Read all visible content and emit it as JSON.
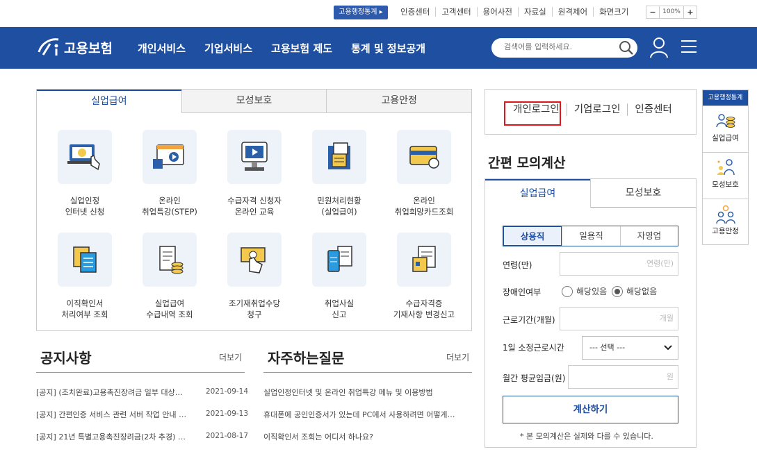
{
  "top": {
    "stat_button": "고용행정통계 ▸",
    "links": [
      "인증센터",
      "고객센터",
      "용어사전",
      "자료실",
      "원격제어",
      "화면크기"
    ],
    "zoom": {
      "minus": "−",
      "value": "100%",
      "plus": "+"
    }
  },
  "nav": {
    "logo_text": "고용보험",
    "menu": [
      "개인서비스",
      "기업서비스",
      "고용보험 제도",
      "통계 및 정보공개"
    ],
    "search_placeholder": "검색어를 입력하세요."
  },
  "service_tabs": [
    "실업급여",
    "모성보호",
    "고용안정"
  ],
  "services": [
    {
      "line1": "실업인정",
      "line2": "인터넷 신청",
      "icon": "monitor-hand-icon"
    },
    {
      "line1": "온라인",
      "line2": "취업특강(STEP)",
      "icon": "video-lecture-icon"
    },
    {
      "line1": "수급자격 신청자",
      "line2": "온라인 교육",
      "icon": "kiosk-play-icon"
    },
    {
      "line1": "민원처리현황",
      "line2": "(실업급여)",
      "icon": "document-stack-icon"
    },
    {
      "line1": "온라인",
      "line2": "취업희망카드조회",
      "icon": "card-icon"
    },
    {
      "line1": "이직확인서",
      "line2": "처리여부 조회",
      "icon": "documents-icon"
    },
    {
      "line1": "실업급여",
      "line2": "수급내역 조회",
      "icon": "receipt-coins-icon"
    },
    {
      "line1": "조기재취업수당",
      "line2": "청구",
      "icon": "money-hand-icon"
    },
    {
      "line1": "취업사실",
      "line2": "신고",
      "icon": "phone-document-icon"
    },
    {
      "line1": "수급자격증",
      "line2": "기재사항 변경신고",
      "icon": "certificate-icon"
    }
  ],
  "notice": {
    "title": "공지사항",
    "more": "더보기",
    "items": [
      {
        "text": "[공지] (조치완료)고용촉진장려금 일부 대상…",
        "date": "2021-09-14"
      },
      {
        "text": "[공지] 간편인증 서비스 관련 서버 작업 안내 …",
        "date": "2021-09-13"
      },
      {
        "text": "[공지] 21년 특별고용촉진장려금(2차 추경) …",
        "date": "2021-08-17"
      }
    ]
  },
  "faq": {
    "title": "자주하는질문",
    "more": "더보기",
    "items": [
      "실업인정인터넷 및 온라인 취업특강 메뉴 및 이용방법",
      "휴대폰에 공인인증서가 있는데 PC에서 사용하려면 어떻게…",
      "이직확인서 조회는 어디서 하나요?"
    ]
  },
  "login": [
    "개인로그인",
    "기업로그인",
    "인증센터"
  ],
  "calc": {
    "title": "간편 모의계산",
    "tabs": [
      "실업급여",
      "모성보호"
    ],
    "segments": [
      "상용직",
      "일용직",
      "자영업"
    ],
    "age_label": "연령(만)",
    "age_placeholder": "연령(만)",
    "disability_label": "장애인여부",
    "radio_yes": "해당있음",
    "radio_no": "해당없음",
    "period_label": "근로기간(개월)",
    "period_placeholder": "개월",
    "hours_label": "1일 소정근로시간",
    "hours_select": "--- 선택 ---",
    "wage_label": "월간 평균임금(원)",
    "wage_placeholder": "원",
    "button": "계산하기",
    "note": "* 본 모의계산은 실제와 다를 수 있습니다."
  },
  "quick": {
    "header": "고용행정통계",
    "items": [
      "실업급여",
      "모성보호",
      "고용안정"
    ]
  },
  "colors": {
    "brand": "#1e4fa0",
    "highlight": "#e0141b"
  }
}
